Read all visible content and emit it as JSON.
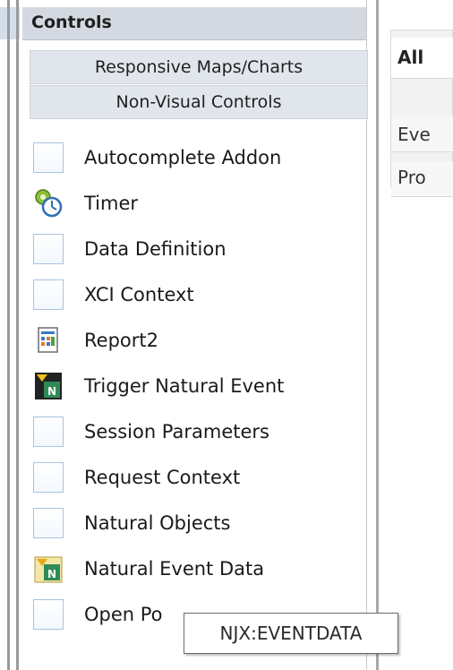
{
  "panel": {
    "header": "Controls",
    "categories": [
      {
        "label": "Responsive Maps/Charts"
      },
      {
        "label": "Non-Visual Controls"
      }
    ],
    "items": [
      {
        "label": "Autocomplete Addon",
        "icon": "blank-control-icon"
      },
      {
        "label": "Timer",
        "icon": "timer-icon"
      },
      {
        "label": "Data Definition",
        "icon": "blank-control-icon"
      },
      {
        "label": "XCI Context",
        "icon": "blank-control-icon"
      },
      {
        "label": "Report2",
        "icon": "report-icon"
      },
      {
        "label": "Trigger Natural Event",
        "icon": "natural-event-icon"
      },
      {
        "label": "Session Parameters",
        "icon": "blank-control-icon"
      },
      {
        "label": "Request Context",
        "icon": "blank-control-icon"
      },
      {
        "label": "Natural Objects",
        "icon": "blank-control-icon"
      },
      {
        "label": "Natural Event Data",
        "icon": "natural-event-data-icon"
      },
      {
        "label": "Open Po",
        "icon": "blank-control-icon"
      }
    ]
  },
  "tabs": [
    {
      "label": "All"
    },
    {
      "label": "Eve"
    },
    {
      "label": "Pro"
    }
  ],
  "tooltip": "NJX:EVENTDATA",
  "colors": {
    "header_bg": "#d4d9e1",
    "category_bg": "#e1e6ed",
    "icon_border": "#a9c3de"
  }
}
